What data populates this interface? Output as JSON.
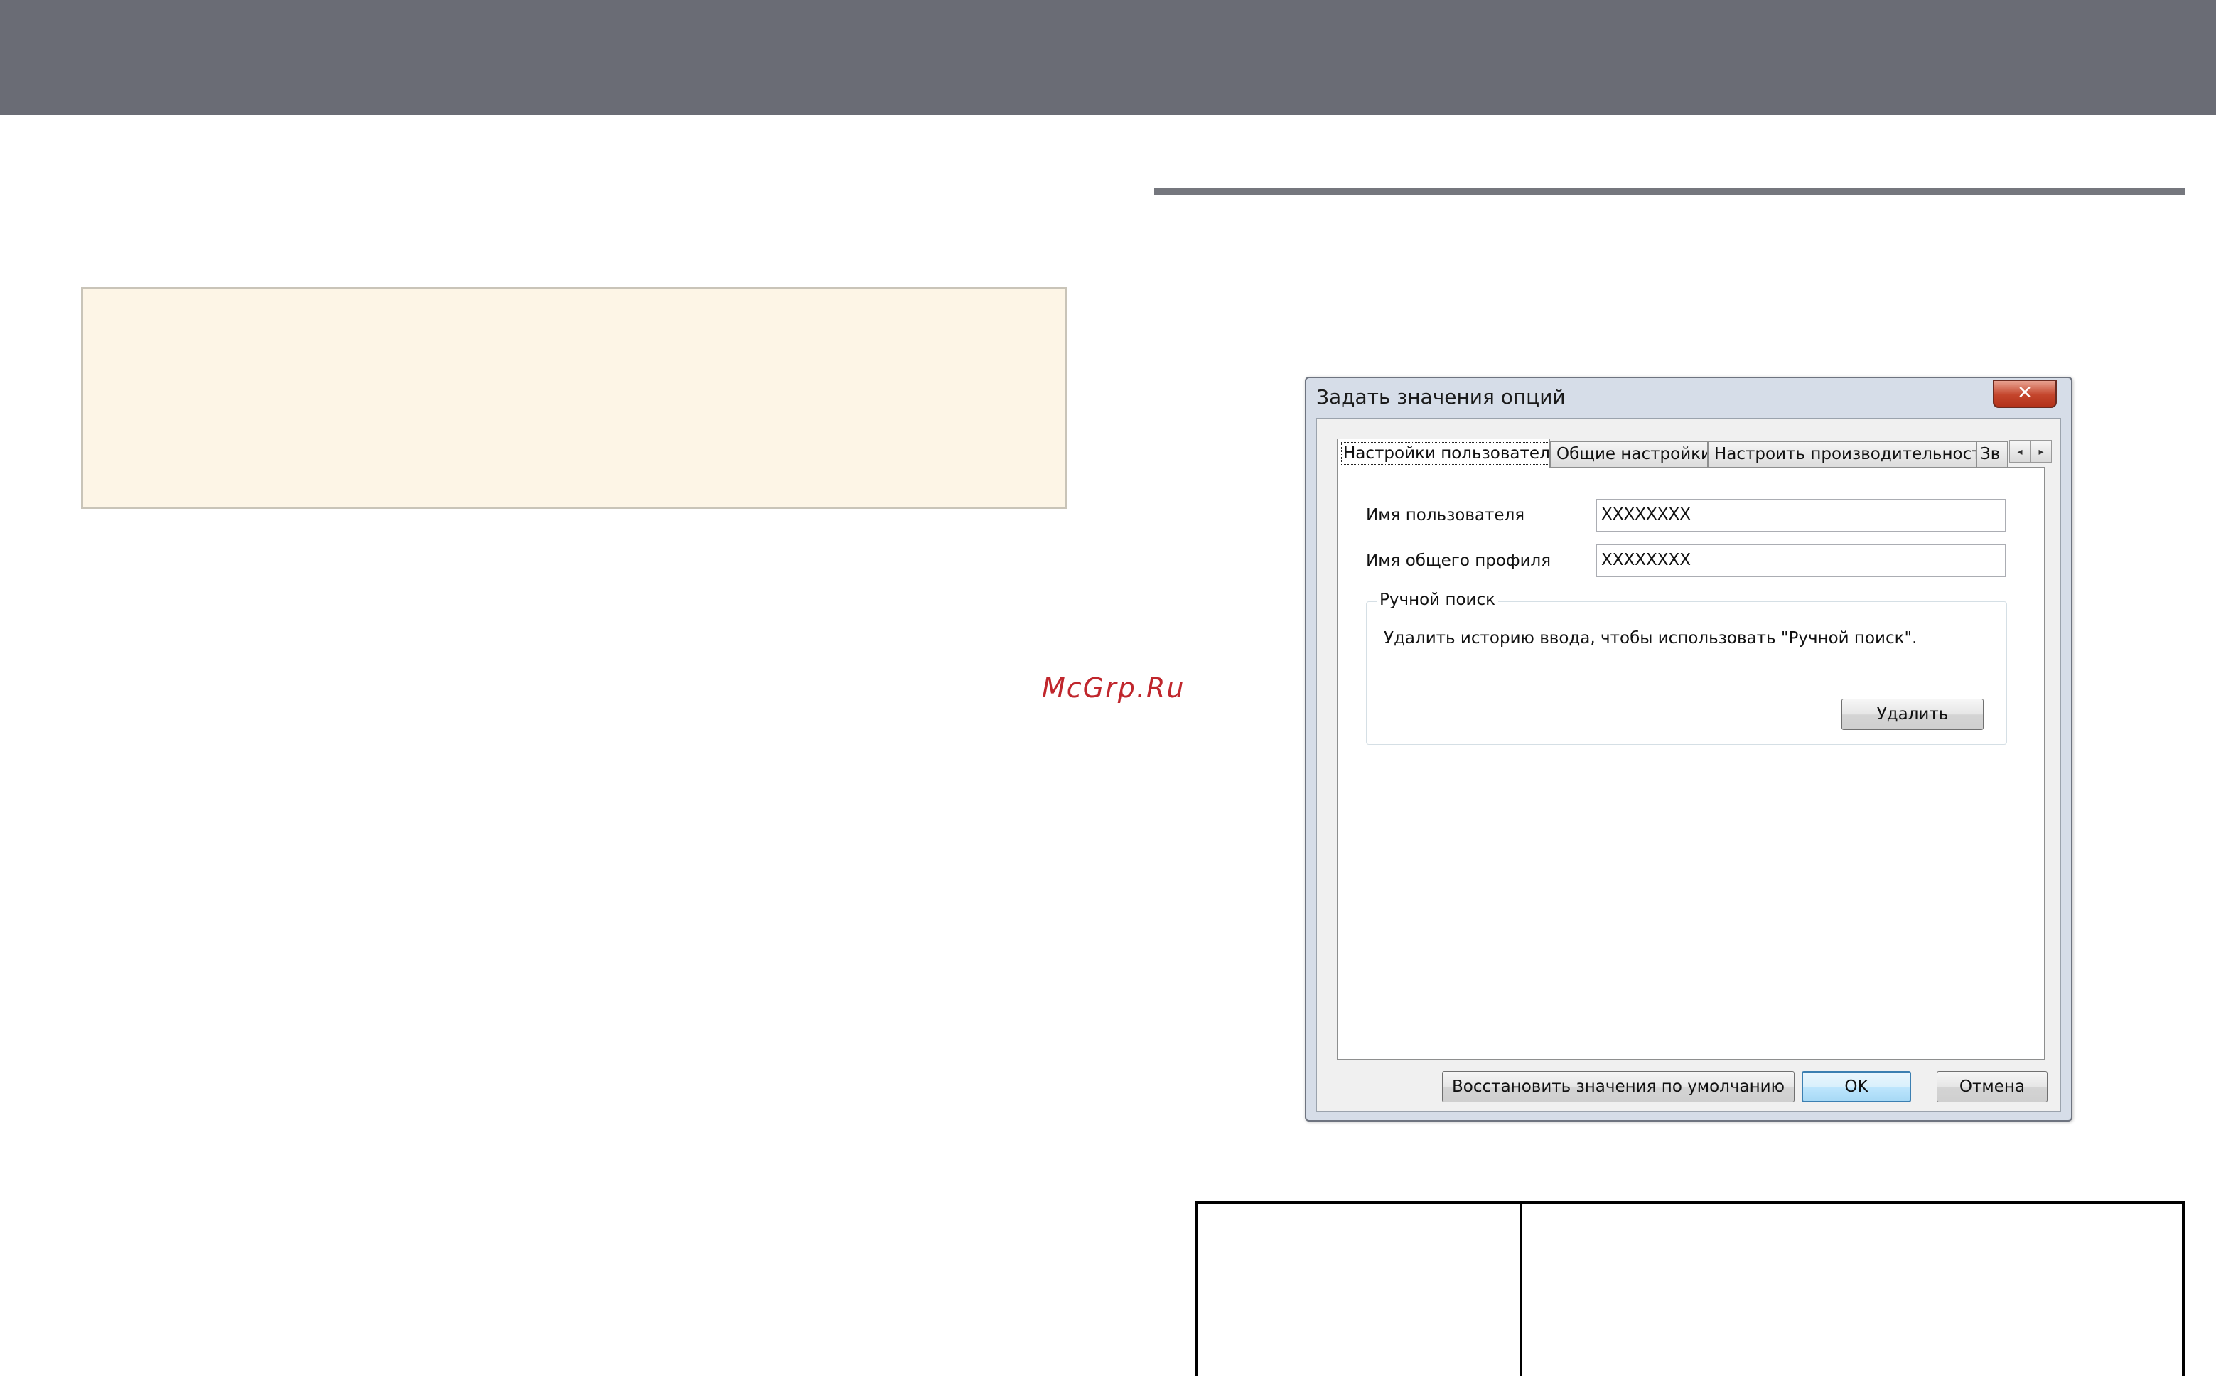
{
  "watermark": "McGrp.Ru",
  "dialog": {
    "title": "Задать значения опций",
    "close_glyph": "✕",
    "tabs": [
      {
        "label": "Настройки пользователя",
        "active": true
      },
      {
        "label": "Общие настройки",
        "active": false
      },
      {
        "label": "Настроить производительность",
        "active": false
      },
      {
        "label": "Зв",
        "active": false
      }
    ],
    "tab_scroll": {
      "left_icon": "◂",
      "right_icon": "▸"
    },
    "fields": {
      "user_name_label": "Имя пользователя",
      "user_name_value": "XXXXXXXX",
      "shared_profile_label": "Имя общего профиля",
      "shared_profile_value": "XXXXXXXX"
    },
    "manual_search": {
      "title": "Ручной поиск",
      "description": "Удалить историю ввода, чтобы использовать \"Ручной поиск\".",
      "delete_button": "Удалить"
    },
    "footer": {
      "restore_defaults": "Восстановить значения по умолчанию",
      "ok": "OK",
      "cancel": "Отмена"
    }
  }
}
